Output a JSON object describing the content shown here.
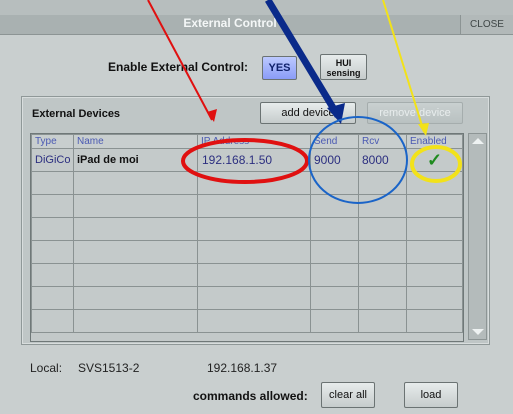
{
  "window": {
    "title": "External Control",
    "close_label": "CLOSE"
  },
  "enable": {
    "label": "Enable External Control:",
    "yes_label": "YES",
    "hui_label_line1": "HUI",
    "hui_label_line2": "sensing"
  },
  "devices": {
    "title": "External Devices",
    "add_label": "add device",
    "remove_label": "remove device",
    "columns": [
      "Type",
      "Name",
      "IP Address",
      "Send",
      "Rcv",
      "Enabled"
    ],
    "rows": [
      {
        "type": "DiGiCo",
        "name": "iPad de moi",
        "ip": "192.168.1.50",
        "send": "9000",
        "rcv": "8000",
        "enabled": "✓"
      }
    ]
  },
  "local": {
    "label": "Local:",
    "name": "SVS1513-2",
    "ip": "192.168.1.37"
  },
  "commands": {
    "label": "commands allowed:",
    "clear_label": "clear all",
    "load_label": "load"
  },
  "colors": {
    "annotation_red": "#e01010",
    "annotation_blue": "#1a64c8",
    "annotation_yellow": "#f2e21a",
    "arrow_dark_blue": "#0a2a8a"
  }
}
